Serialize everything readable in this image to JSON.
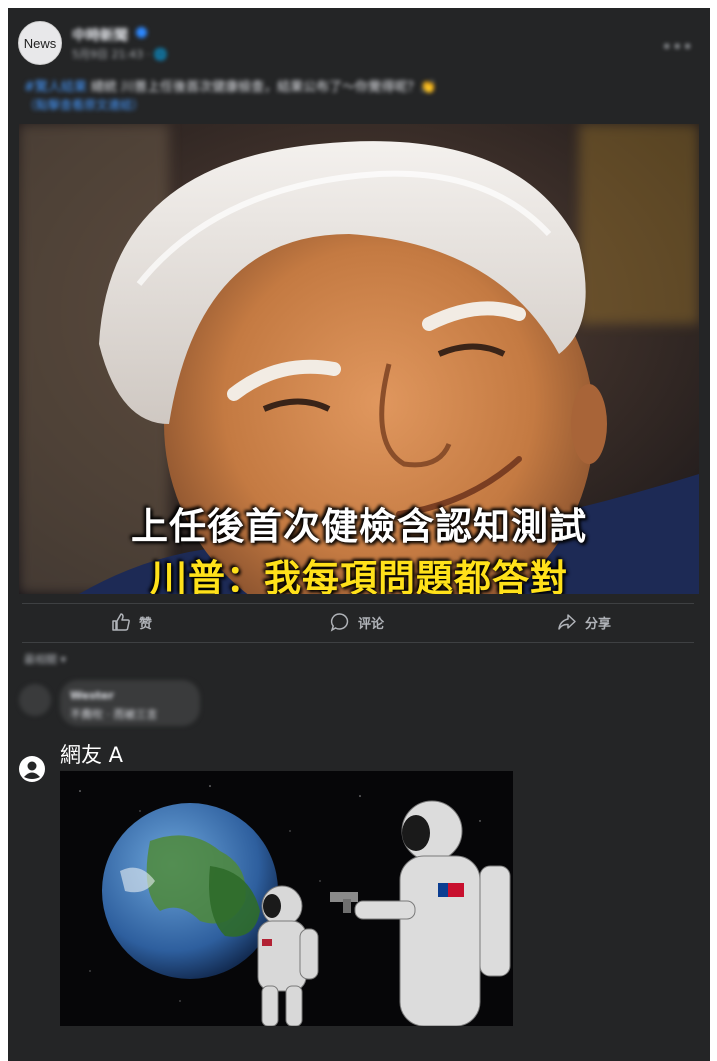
{
  "post": {
    "avatar_label": "News",
    "page_name": "中時新聞",
    "meta": "5月9日 21:43 · 🌐",
    "caption_tag": "#驚人結果",
    "caption_text": "總統 川普上任後首次健康檢查，結果公布了～你覺得呢？👏",
    "caption_link": "（點擊查看原文連結）",
    "more_icon": "more-horizontal-icon"
  },
  "image": {
    "headline_line1": "上任後首次健檢含認知測試",
    "headline_line2": "川普：我每項問題都答對"
  },
  "actions": [
    {
      "label": "赞",
      "icon": "thumbs-up-icon"
    },
    {
      "label": "评论",
      "icon": "comment-bubble-icon"
    },
    {
      "label": "分享",
      "icon": "share-arrow-icon"
    }
  ],
  "comments": {
    "sort_label": "最相關 ▾",
    "first": {
      "name": "Wester",
      "text": "不費吹 · 而被三言"
    }
  },
  "reply": {
    "user_name": "網友 A",
    "user_icon": "user-circle-icon"
  },
  "colors": {
    "background": "#242526",
    "text": "#e4e6eb",
    "secondary": "#b0b3b8",
    "link": "#4599ff",
    "headline_yellow": "#ffe11a"
  }
}
